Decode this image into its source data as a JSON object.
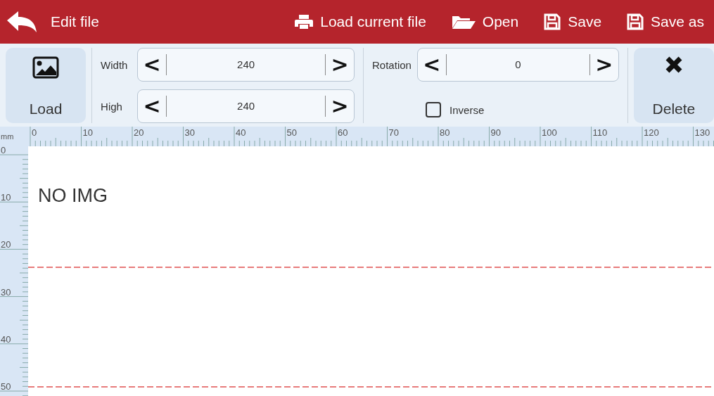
{
  "header": {
    "title": "Edit file",
    "actions": [
      {
        "kind": "print",
        "label": "Load current file"
      },
      {
        "kind": "folder",
        "label": "Open"
      },
      {
        "kind": "save",
        "label": "Save"
      },
      {
        "kind": "save",
        "label": "Save as"
      }
    ]
  },
  "toolbar": {
    "load_button": "Load",
    "delete_button": "Delete",
    "spinners": [
      {
        "label": "Width",
        "value": "240",
        "prev": "<",
        "next": ">"
      },
      {
        "label": "High",
        "value": "240",
        "prev": "<",
        "next": ">"
      },
      {
        "label": "Rotation",
        "value": "0",
        "prev": "<",
        "next": ">"
      }
    ],
    "inverse": {
      "label": "Inverse",
      "checked": false
    }
  },
  "ruler": {
    "unit": "mm",
    "x_labels": [
      "0",
      "10",
      "20",
      "30",
      "40",
      "50",
      "60",
      "70",
      "80",
      "90",
      "100",
      "110",
      "120",
      "130"
    ],
    "y_labels": [
      "0",
      "10",
      "20",
      "30",
      "40",
      "50"
    ]
  },
  "canvas": {
    "message": "NO IMG"
  }
}
